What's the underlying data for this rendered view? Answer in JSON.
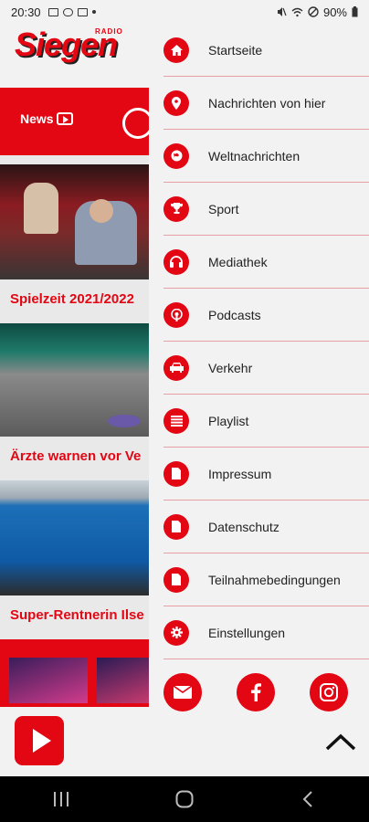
{
  "status_bar": {
    "time": "20:30",
    "battery": "90%"
  },
  "app": {
    "logo_small": "RADIO",
    "logo": "Siegen",
    "news_label": "News",
    "articles": [
      {
        "title": "Spielzeit 2021/2022"
      },
      {
        "title": "Ärzte warnen vor Ve"
      },
      {
        "title": "Super-Rentnerin Ilse"
      }
    ]
  },
  "menu": {
    "items": [
      {
        "label": "Startseite",
        "icon": "home-icon"
      },
      {
        "label": "Nachrichten von hier",
        "icon": "location-pin-icon"
      },
      {
        "label": "Weltnachrichten",
        "icon": "globe-icon"
      },
      {
        "label": "Sport",
        "icon": "trophy-icon"
      },
      {
        "label": "Mediathek",
        "icon": "headphones-icon"
      },
      {
        "label": "Podcasts",
        "icon": "podcast-icon"
      },
      {
        "label": "Verkehr",
        "icon": "car-icon"
      },
      {
        "label": "Playlist",
        "icon": "list-icon"
      },
      {
        "label": "Impressum",
        "icon": "document-icon"
      },
      {
        "label": "Datenschutz",
        "icon": "document-icon"
      },
      {
        "label": "Teilnahmebedingungen",
        "icon": "document-icon"
      },
      {
        "label": "Einstellungen",
        "icon": "gear-icon"
      }
    ],
    "social": [
      {
        "name": "email-icon"
      },
      {
        "name": "facebook-icon"
      },
      {
        "name": "instagram-icon"
      }
    ]
  },
  "colors": {
    "brand_red": "#e30613",
    "divider": "#e8a0a6",
    "background": "#f2f2f2"
  }
}
